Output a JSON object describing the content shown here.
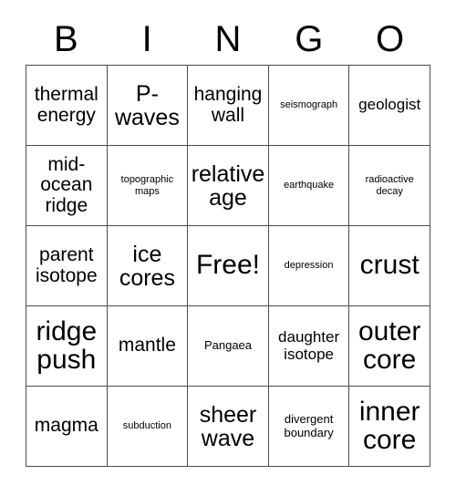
{
  "card": {
    "title": "BINGO",
    "header": {
      "letters": [
        "B",
        "I",
        "N",
        "G",
        "O"
      ]
    },
    "grid": {
      "columns": 5,
      "rows": 5,
      "border_color": "#4d4d4d",
      "background_color": "#ffffff",
      "text_color": "#000000",
      "free_space": {
        "label": "Free!",
        "row": 3,
        "column": 3
      },
      "cells": [
        [
          {
            "text": "thermal energy",
            "size": "fs-l"
          },
          {
            "text": "P-waves",
            "size": "fs-xl"
          },
          {
            "text": "hanging wall",
            "size": "fs-l"
          },
          {
            "text": "seismograph",
            "size": "fs-xs"
          },
          {
            "text": "geologist",
            "size": "fs-m"
          }
        ],
        [
          {
            "text": "mid-ocean ridge",
            "size": "fs-l"
          },
          {
            "text": "topographic maps",
            "size": "fs-xs"
          },
          {
            "text": "relative age",
            "size": "fs-xl"
          },
          {
            "text": "earthquake",
            "size": "fs-xs"
          },
          {
            "text": "radioactive decay",
            "size": "fs-xs"
          }
        ],
        [
          {
            "text": "parent isotope",
            "size": "fs-l"
          },
          {
            "text": "ice cores",
            "size": "fs-xl"
          },
          {
            "text": "Free!",
            "size": "fs-xxl"
          },
          {
            "text": "depression",
            "size": "fs-xs"
          },
          {
            "text": "crust",
            "size": "fs-xxl"
          }
        ],
        [
          {
            "text": "ridge push",
            "size": "fs-xxl"
          },
          {
            "text": "mantle",
            "size": "fs-l"
          },
          {
            "text": "Pangaea",
            "size": "fs-s"
          },
          {
            "text": "daughter isotope",
            "size": "fs-m"
          },
          {
            "text": "outer core",
            "size": "fs-xxl"
          }
        ],
        [
          {
            "text": "magma",
            "size": "fs-l"
          },
          {
            "text": "subduction",
            "size": "fs-xs"
          },
          {
            "text": "sheer wave",
            "size": "fs-xl"
          },
          {
            "text": "divergent boundary",
            "size": "fs-s"
          },
          {
            "text": "inner core",
            "size": "fs-xxl"
          }
        ]
      ]
    }
  }
}
